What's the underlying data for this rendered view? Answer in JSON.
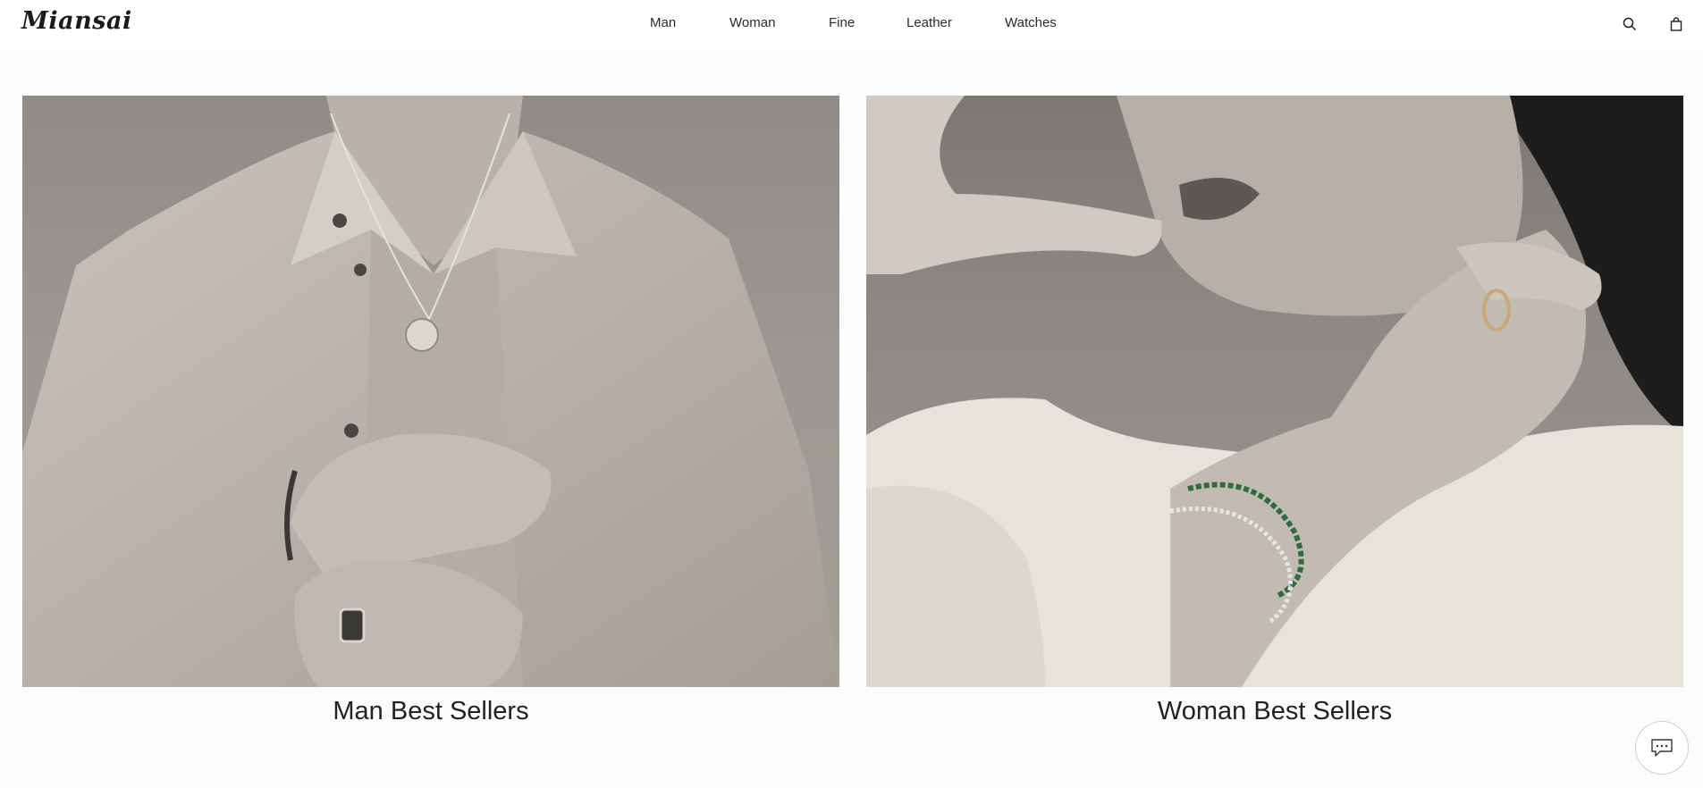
{
  "header": {
    "logo_text": "Miansai",
    "nav": [
      "Man",
      "Woman",
      "Fine",
      "Leather",
      "Watches"
    ],
    "icons": {
      "search": "search-icon",
      "bag": "shopping-bag-icon"
    }
  },
  "panels": [
    {
      "caption": "Man Best Sellers",
      "image": "man-jewelry-photo"
    },
    {
      "caption": "Woman Best Sellers",
      "image": "woman-jewelry-photo"
    }
  ],
  "chat": {
    "icon": "chat-icon"
  },
  "colors": {
    "background": "#fcfcfc",
    "text": "#1a1a1a",
    "border": "#cfcfcf"
  }
}
